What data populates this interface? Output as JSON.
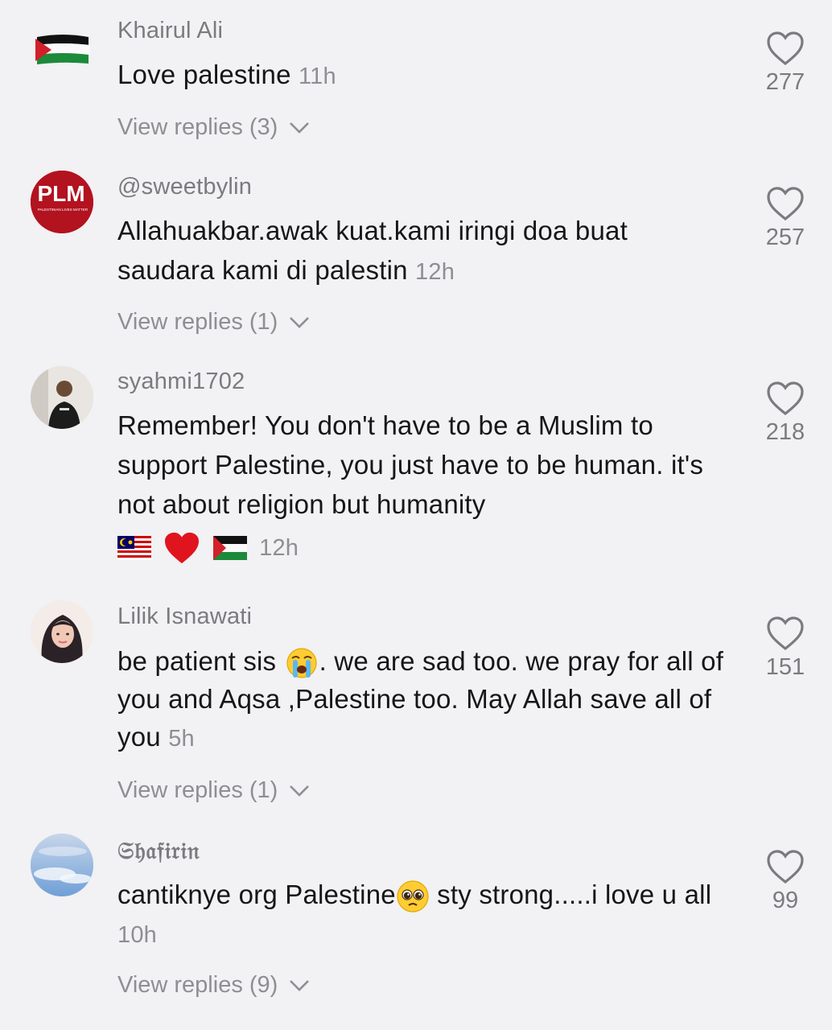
{
  "comments": [
    {
      "username": "Khairul Ali",
      "text": "Love palestine",
      "time": "11h",
      "replies": "View replies (3)",
      "likes": "277",
      "avatar_icon": "palestine-flag-icon"
    },
    {
      "username": "@sweetbylin",
      "text": "Allahuakbar.awak kuat.kami iringi doa buat saudara kami di palestin",
      "time": "12h",
      "replies": "View replies (1)",
      "likes": "257",
      "avatar_text": "PLM",
      "avatar_subtext": "PALESTINIAN LIVES MATTER",
      "avatar_icon": "plm-logo-icon"
    },
    {
      "username": "syahmi1702",
      "text": "Remember! You don't have to be a Muslim to support Palestine, you just have to be human. it's not about religion but humanity",
      "time": "12h",
      "replies": "",
      "likes": "218",
      "avatar_icon": "person-photo-icon",
      "trailing_emojis": [
        "malaysia-flag-icon",
        "red-heart-icon",
        "palestine-flag-icon"
      ]
    },
    {
      "username": "Lilik Isnawati",
      "text_part1": "be patient sis",
      "text_part2": ". we are sad too. we pray for all of you and Aqsa ,Palestine too. May Allah save all of you",
      "time": "5h",
      "replies": "View replies (1)",
      "likes": "151",
      "avatar_icon": "person-hijab-photo-icon",
      "inline_emoji": "crying-face-icon"
    },
    {
      "username": "𝔖𝔥𝔞𝔣𝔦𝔯𝔦𝔫",
      "text_part1": "cantiknye org Palestine",
      "text_part2": " sty strong.....i love u all",
      "time": "10h",
      "replies": "View replies (9)",
      "likes": "99",
      "avatar_icon": "sky-photo-icon",
      "inline_emoji": "pleading-face-icon"
    }
  ],
  "colors": {
    "background": "#f2f1f3",
    "text": "#161616",
    "muted": "#8e8e93"
  }
}
